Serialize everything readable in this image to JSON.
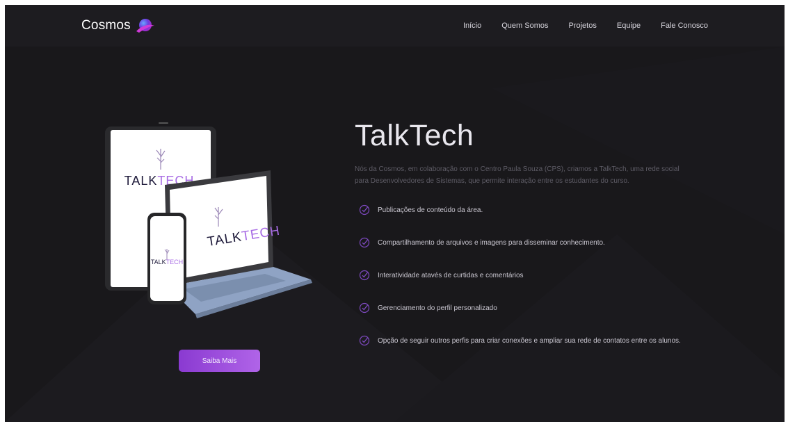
{
  "brand": {
    "name": "Cosmos",
    "logo_icon": "planet-icon"
  },
  "nav": {
    "links": [
      "Início",
      "Quem Somos",
      "Projetos",
      "Equipe",
      "Fale Conosco"
    ]
  },
  "hero": {
    "title": "TalkTech",
    "description": "Nós da Cosmos, em colaboração com o Centro Paula Souza (CPS), criamos a TalkTech, uma rede social para Desenvolvedores de Sistemas, que permite interação entre os estudantes do curso.",
    "device_logo": {
      "left": "T",
      "right": "ALK",
      "tail": "TECH"
    },
    "features": [
      "Publicações de conteúdo da área.",
      "Compartilhamento de arquivos e imagens para disseminar conhecimento.",
      "Interatividade atavés de curtidas e comentários",
      "Gerenciamento do perfil personalizado",
      "Opção de seguir outros perfis para criar conexões e ampliar sua rede de contatos entre os alunos."
    ],
    "cta_label": "Saiba Mais"
  },
  "colors": {
    "background": "#19181b",
    "navbar": "#1d1c20",
    "accent": "#9b4ddc",
    "logo_purple": "#a86ce4",
    "check": "#7f4ac2"
  }
}
